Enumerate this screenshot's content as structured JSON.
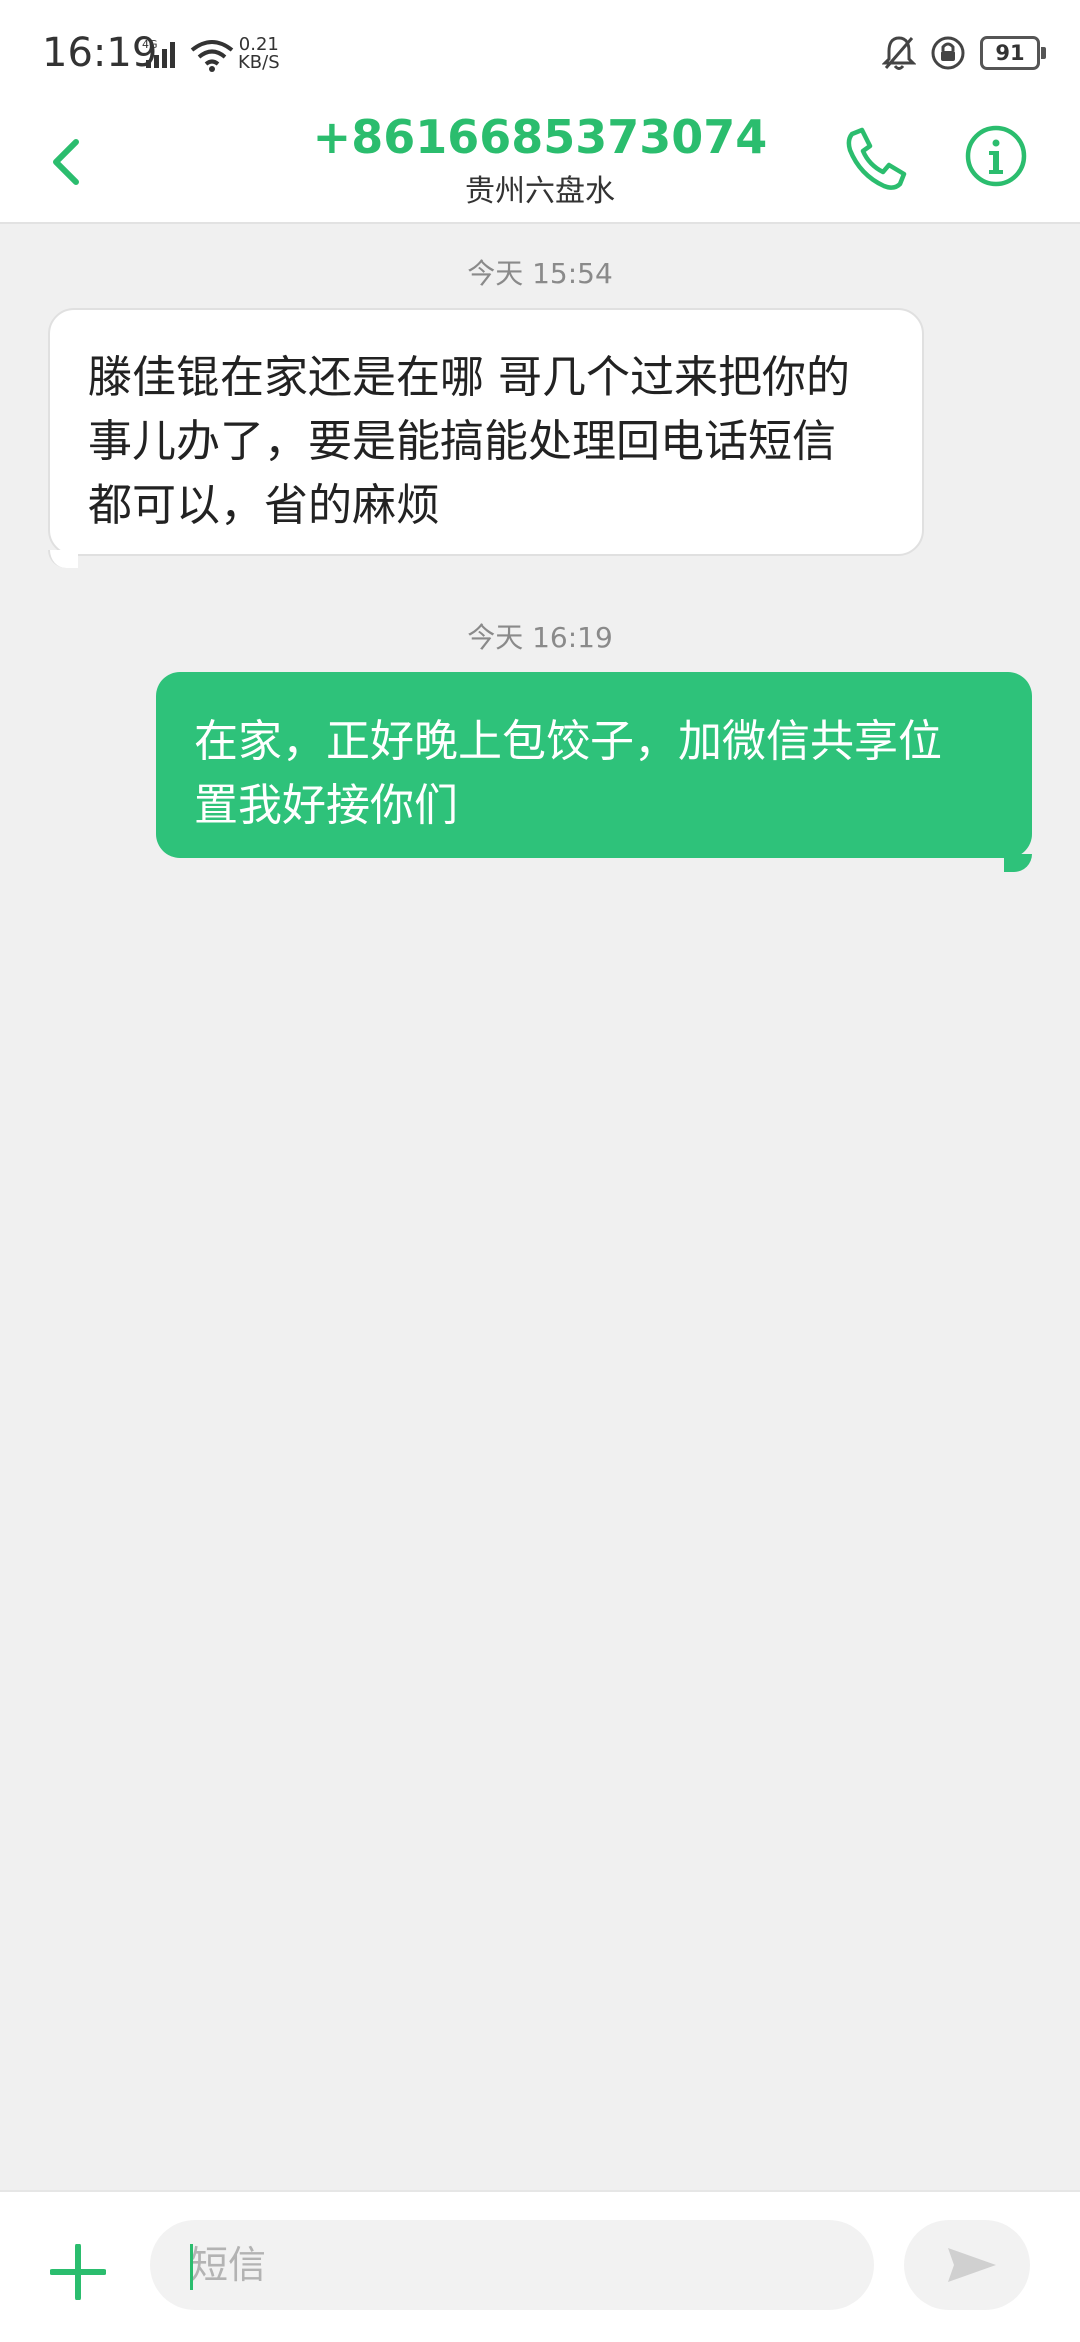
{
  "status_bar": {
    "time": "16:19",
    "network": "4G",
    "speed_value": "0.21",
    "speed_unit": "KB/S",
    "battery": "91"
  },
  "header": {
    "title": "+8616685373074",
    "subtitle": "贵州六盘水"
  },
  "messages": [
    {
      "timestamp": "今天 15:54",
      "direction": "incoming",
      "lines": [
        "滕佳锟在家还是在哪 哥几个过来把你的",
        "事儿办了，要是能搞能处理回电话短信",
        "都可以，省的麻烦"
      ]
    },
    {
      "timestamp": "今天 16:19",
      "direction": "outgoing",
      "lines": [
        "在家，正好晚上包饺子，加微信共享位",
        "置我好接你们"
      ]
    }
  ],
  "composer": {
    "placeholder": "短信"
  },
  "colors": {
    "accent": "#2bbd6e",
    "outgoing_bubble": "#2ec27a",
    "incoming_bubble": "#ffffff",
    "background": "#f0f0f0"
  },
  "icons": [
    "signal-icon",
    "wifi-icon",
    "mute-bell-icon",
    "rotation-lock-icon",
    "battery-icon",
    "back-icon",
    "phone-icon",
    "info-icon",
    "add-icon",
    "send-icon"
  ]
}
